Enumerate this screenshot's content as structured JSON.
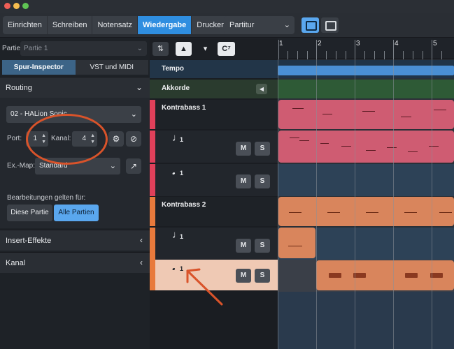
{
  "toolbar": {
    "modes": [
      "Einrichten",
      "Schreiben",
      "Notensatz",
      "Wiedergabe",
      "Drucken"
    ],
    "active_mode": "Wiedergabe",
    "layout_select": "Partitur"
  },
  "left_panel": {
    "partie_label": "Partie:",
    "partie_value": "Partie 1",
    "tabs": [
      "Spur-Inspector",
      "VST und MIDI"
    ],
    "active_tab": "Spur-Inspector",
    "routing": {
      "title": "Routing",
      "instrument": "02 - HALion Sonic",
      "port_label": "Port:",
      "port_value": "1",
      "kanal_label": "Kanal:",
      "kanal_value": "4",
      "exmap_label": "Ex.-Map:",
      "exmap_value": "Standard",
      "apply_label": "Bearbeitungen gelten für:",
      "btn_this": "Diese Partie",
      "btn_all": "Alle Partien"
    },
    "insert_title": "Insert-Effekte",
    "kanal_title": "Kanal"
  },
  "track_tools": {
    "chord_symbol": "C⁷"
  },
  "tracks": {
    "tempo": "Tempo",
    "chords": "Akkorde",
    "kb1": "Kontrabass 1",
    "kb2": "Kontrabass 2",
    "voice": "1",
    "mute": "M",
    "solo": "S"
  },
  "ruler": [
    "1",
    "2",
    "3",
    "4",
    "5"
  ],
  "colors": {
    "accent": "#2f8ee0",
    "kb1": "#e0405a",
    "kb2": "#e87a3c",
    "annotation": "#d9532a"
  }
}
